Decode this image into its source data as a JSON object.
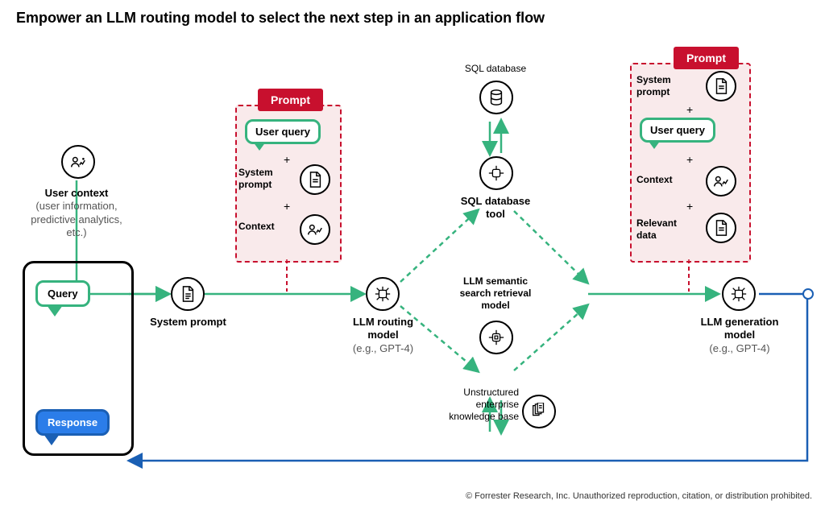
{
  "title": "Empower an LLM routing model to select the next step in an application flow",
  "copyright": "© Forrester Research, Inc. Unauthorized reproduction, citation, or distribution prohibited.",
  "user_context": {
    "heading": "User context",
    "sub": "(user information, predictive analytics, etc.)"
  },
  "query_label": "Query",
  "response_label": "Response",
  "system_prompt_label": "System prompt",
  "routing_model": {
    "heading": "LLM routing model",
    "sub": "(e.g., GPT-4)"
  },
  "sql_db_label": "SQL database",
  "sql_tool_label": "SQL database tool",
  "semantic_label": "LLM semantic search retrieval model",
  "kb_label": "Unstructured enterprise knowledge base",
  "gen_model": {
    "heading": "LLM generation model",
    "sub": "(e.g., GPT-4)"
  },
  "prompt1": {
    "tag": "Prompt",
    "user_query": "User query",
    "system_prompt": "System prompt",
    "context": "Context"
  },
  "prompt2": {
    "tag": "Prompt",
    "system_prompt": "System prompt",
    "user_query": "User query",
    "context": "Context",
    "relevant_data": "Relevant data"
  }
}
